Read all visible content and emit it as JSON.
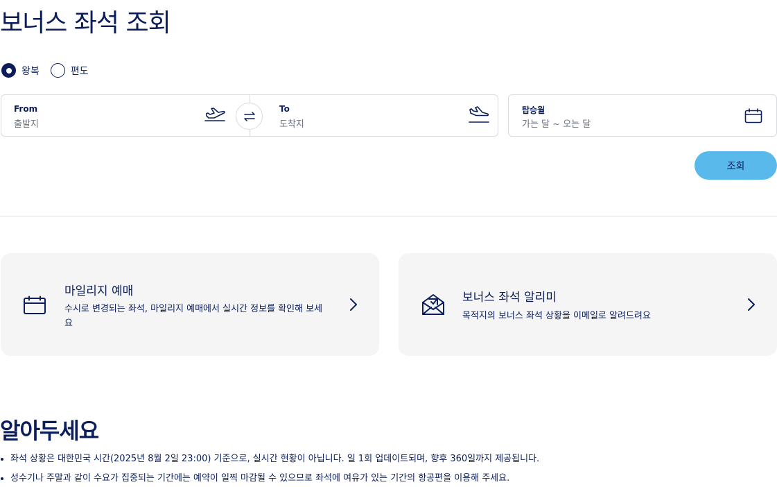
{
  "page": {
    "title": "보너스 좌석 조회"
  },
  "trip_type": {
    "options": [
      {
        "label": "왕복",
        "checked": true
      },
      {
        "label": "편도",
        "checked": false
      }
    ]
  },
  "route": {
    "from": {
      "label": "From",
      "placeholder": "출발지",
      "icon": "takeoff-icon"
    },
    "to": {
      "label": "To",
      "placeholder": "도착지",
      "icon": "landing-icon"
    },
    "swap_icon": "swap-arrows-icon"
  },
  "date": {
    "label": "탑승월",
    "placeholder": "가는 달 ~ 오는 달",
    "icon": "calendar-icon"
  },
  "search": {
    "label": "조회"
  },
  "cards": [
    {
      "title": "마일리지 예매",
      "description": "수시로 변경되는 좌석, 마일리지 예매에서 실시간 정보를 확인해 보세요",
      "icon": "calendar-icon"
    },
    {
      "title": "보너스 좌석 알리미",
      "description": "목적지의 보너스 좌석 상황을 이메일로 알려드려요",
      "icon": "mail-alert-icon"
    }
  ],
  "notice": {
    "title": "알아두세요",
    "items": [
      "좌석 상황은 대한민국 시간(2025년 8월 2일 23:00) 기준으로, 실시간 현황이 아닙니다. 일 1회 업데이트되며, 향후 360일까지 제공됩니다.",
      "성수기나 주말과 같이 수요가 집중되는 기간에는 예약이 일찍 마감될 수 있으므로 좌석에 여유가 있는 기간의 항공편을 이용해 주세요."
    ]
  },
  "colors": {
    "navy": "#0b1e5b",
    "button": "#58b9ea",
    "card_bg": "#f5f5f6",
    "border": "#d9dbe1"
  }
}
